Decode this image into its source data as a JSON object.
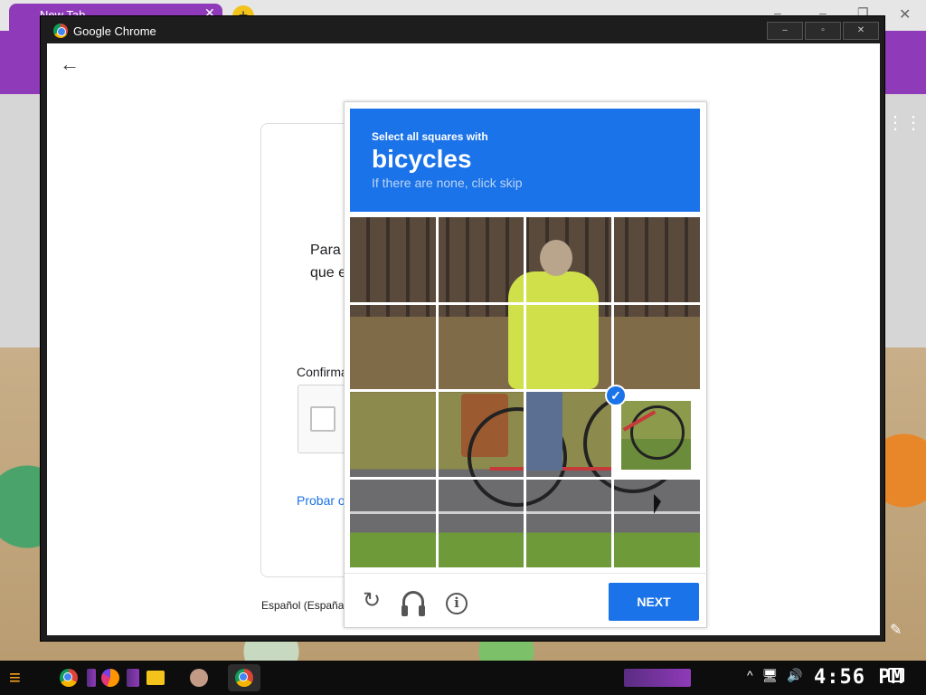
{
  "background_browser": {
    "tab_title": "New Tab",
    "tab_close": "✕",
    "new_tab": "+"
  },
  "window": {
    "title": "Google Chrome",
    "controls": {
      "minimize": "–",
      "maximize": "▫",
      "close": "✕"
    }
  },
  "google_page": {
    "back": "←",
    "text_line1": "Para",
    "text_line2": "que e",
    "confirm_label": "Confirma",
    "link": "Probar o",
    "language": "Español (España"
  },
  "recaptcha": {
    "instruction": "Select all squares with",
    "target": "bicycles",
    "hint": "If there are none, click skip",
    "selected_check": "✓",
    "footer": {
      "reload_icon": "reload-icon",
      "audio_icon": "headphones-icon",
      "info_icon": "info-icon",
      "info_glyph": "i",
      "reload_glyph": "↻",
      "next_label": "NEXT"
    },
    "colors": {
      "accent": "#1a73e8"
    }
  },
  "taskbar": {
    "clock": "4:56 PM",
    "tray": [
      "^",
      "🖥",
      "🔊"
    ]
  }
}
